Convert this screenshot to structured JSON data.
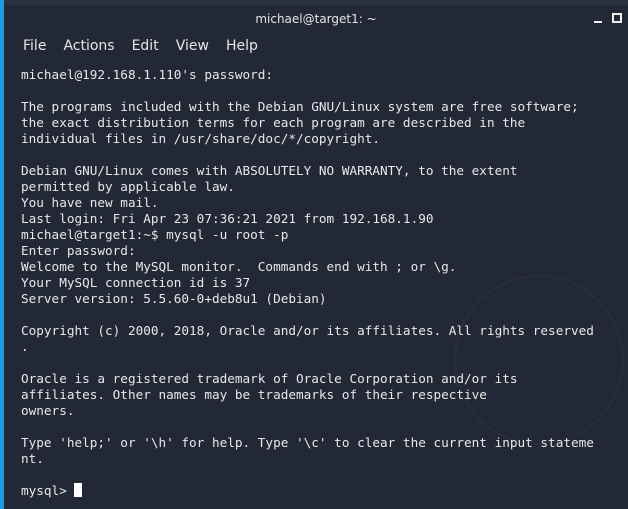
{
  "window": {
    "title": "michael@target1: ~"
  },
  "menu": [
    "File",
    "Actions",
    "Edit",
    "View",
    "Help"
  ],
  "terminal": {
    "lines": [
      "michael@192.168.1.110's password:",
      "",
      "The programs included with the Debian GNU/Linux system are free software;",
      "the exact distribution terms for each program are described in the",
      "individual files in /usr/share/doc/*/copyright.",
      "",
      "Debian GNU/Linux comes with ABSOLUTELY NO WARRANTY, to the extent",
      "permitted by applicable law.",
      "You have new mail.",
      "Last login: Fri Apr 23 07:36:21 2021 from 192.168.1.90",
      "michael@target1:~$ mysql -u root -p",
      "Enter password:",
      "Welcome to the MySQL monitor.  Commands end with ; or \\g.",
      "Your MySQL connection id is 37",
      "Server version: 5.5.60-0+deb8u1 (Debian)",
      "",
      "Copyright (c) 2000, 2018, Oracle and/or its affiliates. All rights reserved",
      ".",
      "",
      "Oracle is a registered trademark of Oracle Corporation and/or its",
      "affiliates. Other names may be trademarks of their respective",
      "owners.",
      "",
      "Type 'help;' or '\\h' for help. Type '\\c' to clear the current input stateme",
      "nt.",
      ""
    ],
    "prompt": "mysql> "
  }
}
